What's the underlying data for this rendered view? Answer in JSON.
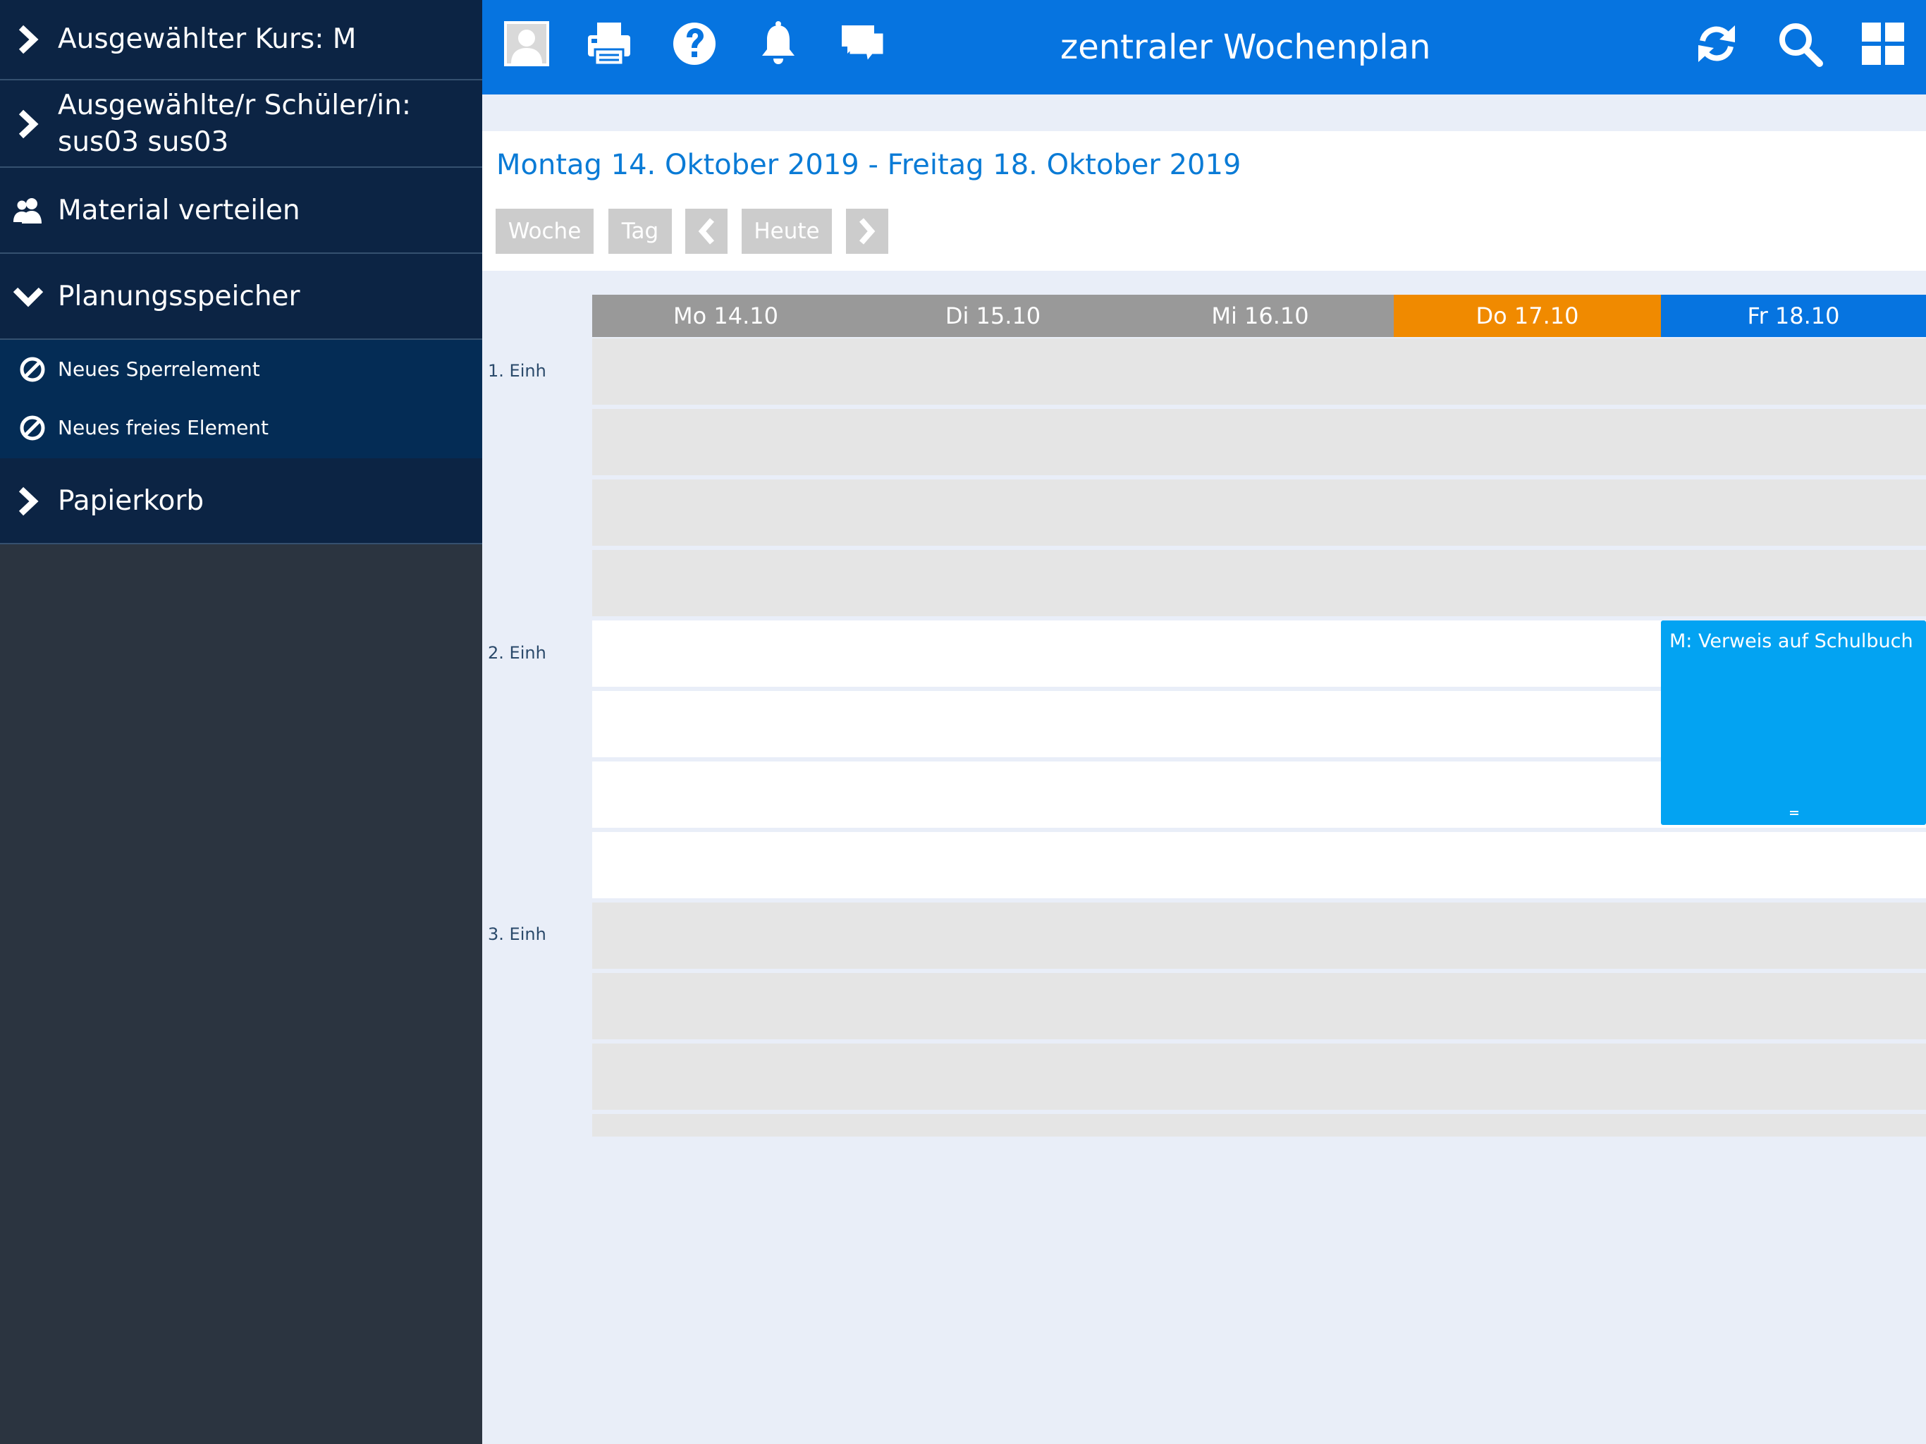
{
  "sidebar": {
    "items": [
      {
        "label": "Ausgewählter Kurs: M",
        "icon": "chevron-right-icon"
      },
      {
        "label": "Ausgewählte/r Schüler/in: sus03 sus03",
        "icon": "chevron-right-icon"
      },
      {
        "label": "Material verteilen",
        "icon": "users-icon"
      },
      {
        "label": "Planungsspeicher",
        "icon": "chevron-down-icon",
        "expanded": true
      },
      {
        "label": "Papierkorb",
        "icon": "chevron-right-icon"
      }
    ],
    "sub_items": [
      {
        "label": "Neues Sperrelement",
        "icon": "block-icon"
      },
      {
        "label": "Neues freies Element",
        "icon": "block-icon"
      }
    ]
  },
  "topbar": {
    "title": "zentraler Wochenplan",
    "left_icons": [
      "avatar-icon",
      "printer-icon",
      "help-icon",
      "bell-icon",
      "chat-icon"
    ],
    "right_icons": [
      "refresh-icon",
      "search-icon",
      "grid-icon"
    ],
    "color": "#0674e0"
  },
  "calendar": {
    "date_range": "Montag 14. Oktober 2019 - Freitag 18. Oktober 2019",
    "buttons": {
      "week": "Woche",
      "day": "Tag",
      "today": "Heute"
    },
    "days": [
      {
        "label": "Mo 14.10",
        "color": "#999999"
      },
      {
        "label": "Di 15.10",
        "color": "#999999"
      },
      {
        "label": "Mi 16.10",
        "color": "#999999"
      },
      {
        "label": "Do 17.10",
        "color": "#f08a00"
      },
      {
        "label": "Fr 18.10",
        "color": "#0674e0"
      }
    ],
    "periods": [
      "1. Einh",
      "2. Einh",
      "3. Einh"
    ],
    "events": [
      {
        "title": "M: Verweis auf Schulbuch",
        "day": "Fr 18.10",
        "period": "2. Einh",
        "color": "#03a3f2"
      }
    ]
  }
}
